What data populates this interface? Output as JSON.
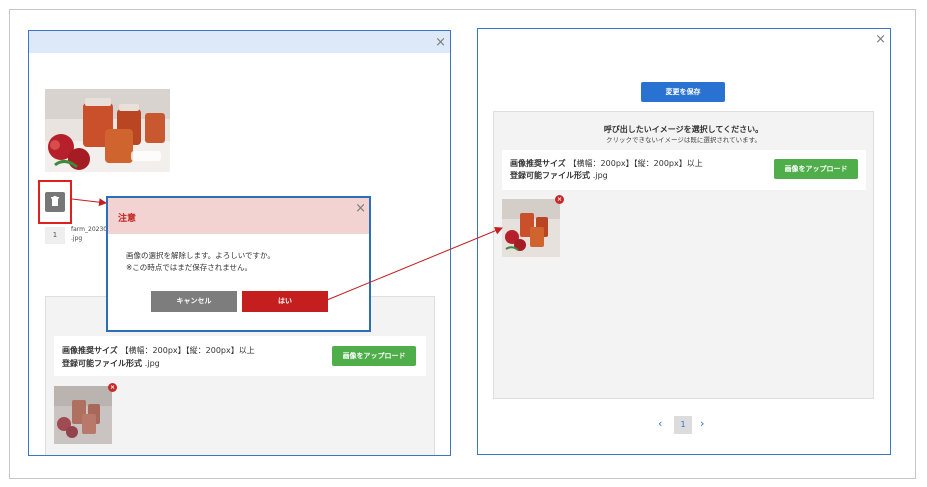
{
  "left_window": {
    "close_glyph": "×",
    "file": {
      "index": "1",
      "name_line1": "farm_20230",
      "name_line2": ".jpg"
    },
    "info": {
      "size_label": "画像推奨サイズ",
      "size_value": "【横幅：200px】【縦：200px】以上",
      "format_label": "登録可能ファイル形式",
      "format_value": ".jpg"
    },
    "upload_label": "画像をアップロード"
  },
  "dialog": {
    "title": "注意",
    "close_glyph": "×",
    "message_line1": "画像の選択を解除します。よろしいですか。",
    "message_line2": "※この時点ではまだ保存されません。",
    "cancel_label": "キャンセル",
    "ok_label": "はい"
  },
  "right_window": {
    "close_glyph": "×",
    "save_label": "変更を保存",
    "instruction_title": "呼び出したいイメージを選択してください。",
    "instruction_sub": "クリックできないイメージは既に選択されています。",
    "info": {
      "size_label": "画像推奨サイズ",
      "size_value": "【横幅：200px】【縦：200px】以上",
      "format_label": "登録可能ファイル形式",
      "format_value": ".jpg"
    },
    "upload_label": "画像をアップロード",
    "pager": {
      "prev": "‹",
      "current": "1",
      "next": "›"
    }
  },
  "colors": {
    "window_border": "#3a76c4",
    "title_bar": "#dde8f8",
    "highlight_red": "#e01f1f",
    "upload_green": "#4fae4a",
    "save_blue": "#2a72d2",
    "ok_red": "#c41e1e",
    "dialog_header": "#f3d2d2"
  }
}
